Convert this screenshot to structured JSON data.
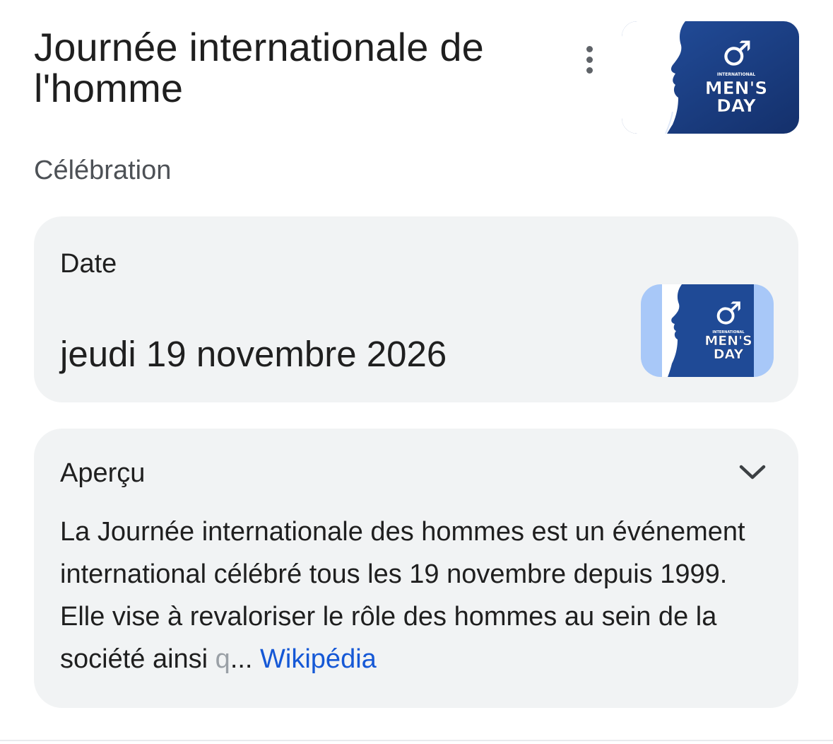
{
  "header": {
    "title": "Journée internationale de l'homme",
    "subtitle": "Célébration",
    "more_icon": "more-vert-icon"
  },
  "hero_image": {
    "lines": [
      "INTERNATIONAL",
      "MEN'S",
      "DAY"
    ],
    "symbol": "♂"
  },
  "date_card": {
    "label": "Date",
    "value": "jeudi 19 novembre 2026",
    "thumb_lines": [
      "INTERNATIONAL",
      "MEN'S",
      "DAY"
    ],
    "thumb_symbol": "♂"
  },
  "overview_card": {
    "label": "Aperçu",
    "expand_icon": "chevron-down-icon",
    "text": "La Journée internationale des hommes est un événement international célébré tous les 19 novembre depuis 1999. Elle vise à revaloriser le rôle des hommes au sein de la société ainsi ",
    "faded_char": "q",
    "ellipsis": "... ",
    "source_link": "Wikipédia"
  },
  "colors": {
    "card_bg": "#f1f3f4",
    "link": "#1558d6",
    "image_blue": "#1b3f8c",
    "image_light_blue": "#a8c8f8"
  }
}
